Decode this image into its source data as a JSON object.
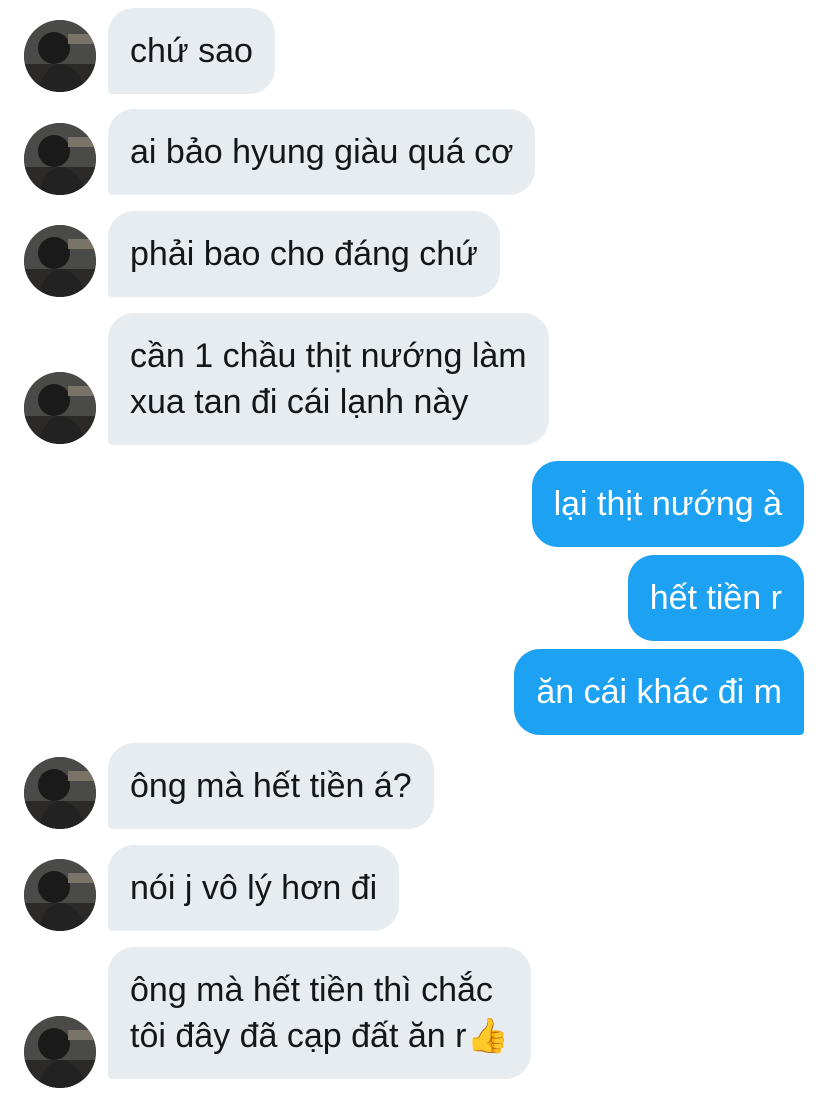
{
  "conversation": {
    "colors": {
      "incoming_bubble": "#e6ecf0",
      "outgoing_bubble": "#1da1f2",
      "incoming_text": "#14171a",
      "outgoing_text": "#ffffff"
    },
    "messages": [
      {
        "sender": "contact",
        "lines": [
          "chứ sao"
        ]
      },
      {
        "sender": "contact",
        "lines": [
          "ai bảo hyung giàu quá cơ"
        ]
      },
      {
        "sender": "contact",
        "lines": [
          "phải bao cho đáng chứ"
        ]
      },
      {
        "sender": "contact",
        "lines": [
          "cần 1 chầu thịt nướng làm",
          "xua tan đi cái lạnh này"
        ]
      },
      {
        "sender": "me",
        "lines": [
          "lại thịt nướng à"
        ]
      },
      {
        "sender": "me",
        "lines": [
          "hết tiền r"
        ]
      },
      {
        "sender": "me",
        "lines": [
          "ăn cái khác đi m"
        ]
      },
      {
        "sender": "contact",
        "lines": [
          "ông mà hết tiền á?"
        ]
      },
      {
        "sender": "contact",
        "lines": [
          "nói j vô lý hơn đi"
        ]
      },
      {
        "sender": "contact",
        "lines": [
          "ông mà hết tiền thì chắc",
          "tôi đây đã cạp đất ăn r"
        ],
        "emoji": "👍",
        "emoji_name": "thumbs-up-emoji"
      }
    ]
  }
}
